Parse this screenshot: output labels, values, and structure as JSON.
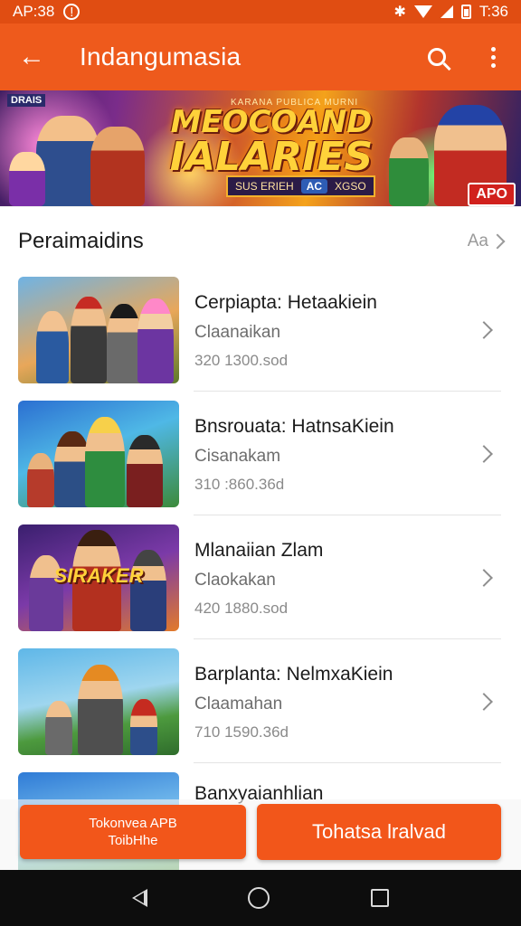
{
  "status_bar": {
    "time": "AP:38",
    "left_icon": "notification-icon",
    "right_text": "T:36",
    "icons": [
      "bluetooth-icon",
      "wifi-icon",
      "signal-icon",
      "battery-icon"
    ]
  },
  "app_bar": {
    "title": "Indangumasia",
    "back_icon": "arrow-left-icon",
    "actions": [
      "search-icon",
      "more-vert-icon"
    ],
    "color": "#ee5a1c"
  },
  "banner": {
    "tag": "DRAIS",
    "sub_top": "KARANA PUBLICA MURNI",
    "title_line1": "MEOCOAND",
    "title_line2": "IALARIES",
    "strip_text": "SUS ERIEH",
    "strip_chip": "AC",
    "strip_right": "XGSO",
    "badge": "APO"
  },
  "section": {
    "title": "Peraimaidins",
    "more_label": "Aa"
  },
  "items": [
    {
      "title": "Cerpiapta: Hetaakiein",
      "subtitle": "Claanaikan",
      "meta": "320  1300.sod",
      "caption": ""
    },
    {
      "title": "Bnsrouata: HatnsaKiein",
      "subtitle": "Cisanakam",
      "meta": "310 :860.36d",
      "caption": ""
    },
    {
      "title": "Mlanaiian Zlam",
      "subtitle": "Claokakan",
      "meta": "420 1880.sod",
      "caption": "SIRAKER"
    },
    {
      "title": "Barplanta: NelmxaKiein",
      "subtitle": "Claamahan",
      "meta": "710  1590.36d",
      "caption": ""
    },
    {
      "title": "Banxyaianhlian",
      "subtitle": "",
      "meta": "",
      "caption": ""
    }
  ],
  "bottom_actions": {
    "secondary_line1": "Tokonvea APB",
    "secondary_line2": "ToibHhe",
    "primary": "Tohatsa lralvad"
  },
  "nav_bar": {
    "icons": [
      "nav-back-icon",
      "nav-home-icon",
      "nav-recents-icon"
    ]
  }
}
